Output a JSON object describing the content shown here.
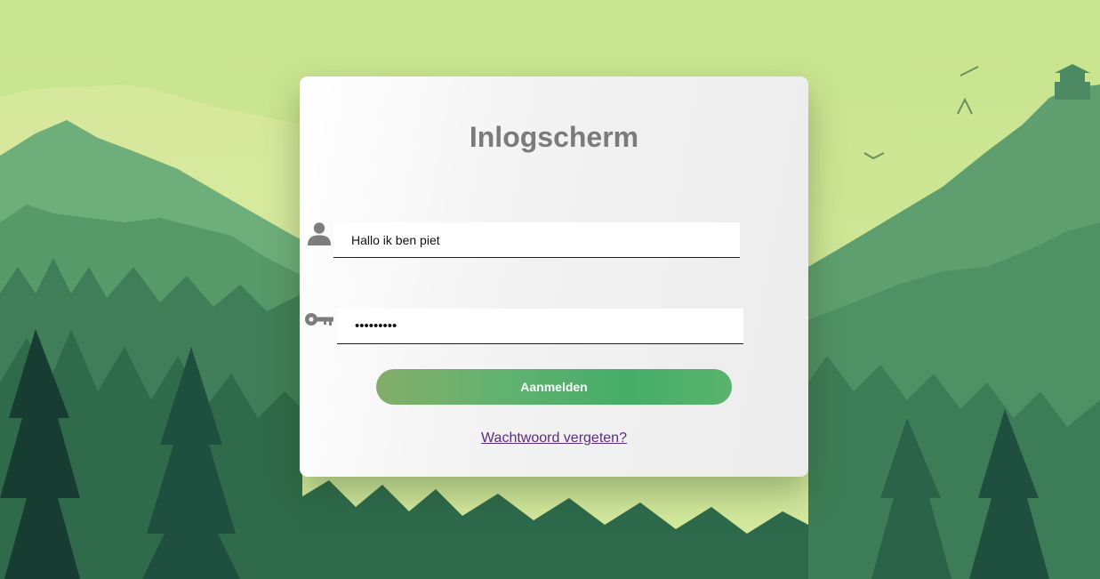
{
  "login": {
    "title": "Inlogscherm",
    "username_value": "Hallo ik ben piet",
    "password_value": "•••••••••",
    "submit_label": "Aanmelden",
    "forgot_link": "Wachtwoord vergeten?"
  },
  "icons": {
    "username": "user-icon",
    "password": "key-icon"
  },
  "colors": {
    "title": "#7b7b7b",
    "button_start": "#84ad6a",
    "button_end": "#45ad68",
    "link": "#5b2b82",
    "sky": "#c9e590"
  }
}
